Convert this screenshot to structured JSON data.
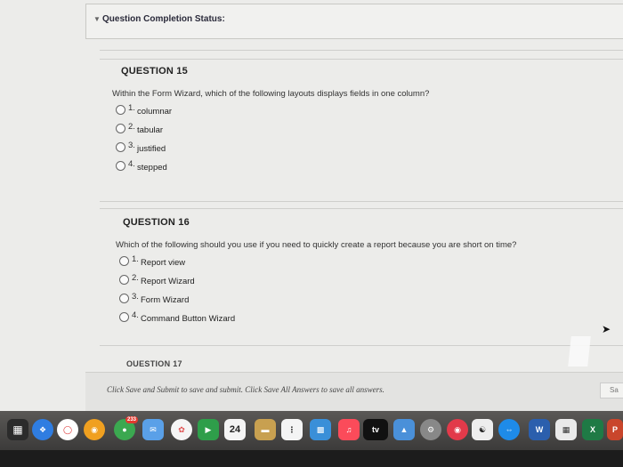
{
  "status": {
    "label": "Question Completion Status:"
  },
  "questions": [
    {
      "title": "QUESTION 15",
      "text": "Within the Form Wizard, which of the following layouts displays fields in one column?",
      "options": [
        {
          "num": "1.",
          "label": "columnar"
        },
        {
          "num": "2.",
          "label": "tabular"
        },
        {
          "num": "3.",
          "label": "justified"
        },
        {
          "num": "4.",
          "label": "stepped"
        }
      ]
    },
    {
      "title": "QUESTION 16",
      "text": "Which of the following should you use if you need to quickly create a report because you are short on time?",
      "options": [
        {
          "num": "1.",
          "label": "Report view"
        },
        {
          "num": "2.",
          "label": "Report Wizard"
        },
        {
          "num": "3.",
          "label": "Form Wizard"
        },
        {
          "num": "4.",
          "label": "Command Button Wizard"
        }
      ]
    }
  ],
  "next_question_title": "QUESTION 17",
  "footer": {
    "message": "Click Save and Submit to save and submit. Click Save All Answers to save all answers.",
    "save_all_label": "Sa"
  },
  "dock": {
    "calendar_day": "24",
    "photos_badge": "233",
    "appletv_label": "tv",
    "word_label": "W",
    "excel_label": "X",
    "powerpoint_label": "P"
  }
}
